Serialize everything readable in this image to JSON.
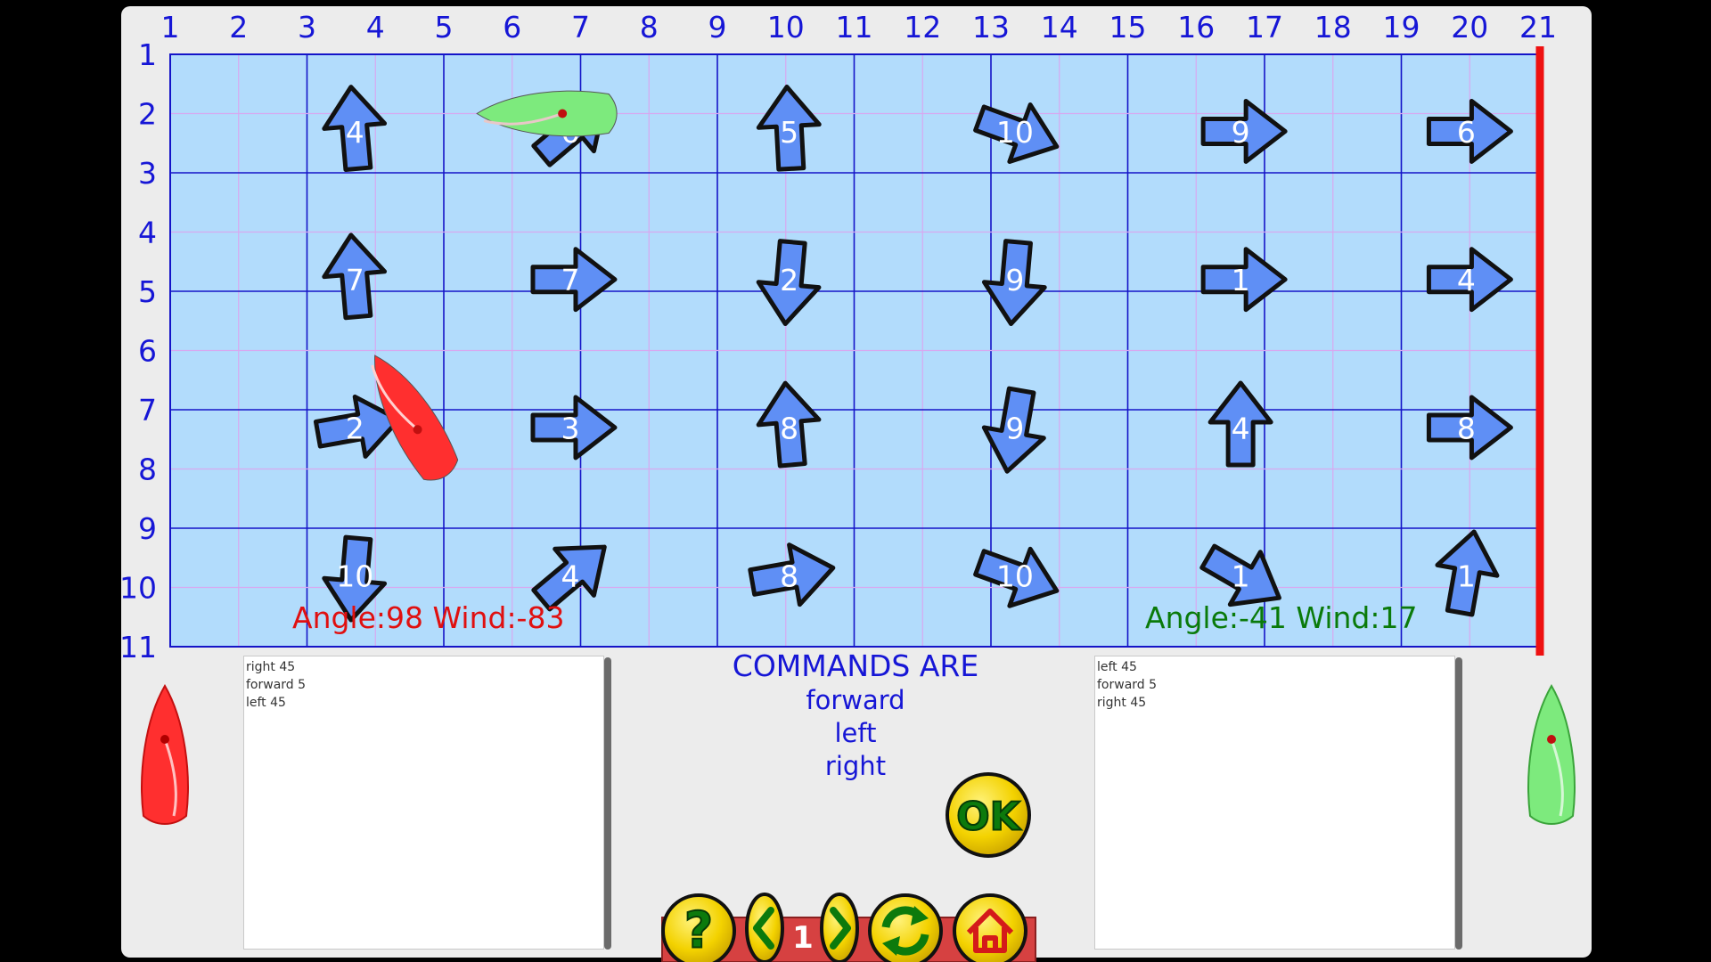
{
  "grid": {
    "columns": [
      "1",
      "2",
      "3",
      "4",
      "5",
      "6",
      "7",
      "8",
      "9",
      "10",
      "11",
      "12",
      "13",
      "14",
      "15",
      "16",
      "17",
      "18",
      "19",
      "20",
      "21"
    ],
    "rows": [
      "1",
      "2",
      "3",
      "4",
      "5",
      "6",
      "7",
      "8",
      "9",
      "10",
      "11"
    ]
  },
  "arrows": [
    {
      "label": "4",
      "col": 3.7,
      "row": 2.3,
      "angle": -5
    },
    {
      "label": "6",
      "col": 6.85,
      "row": 2.3,
      "angle": -40
    },
    {
      "label": "5",
      "col": 10.05,
      "row": 2.3,
      "angle": -3
    },
    {
      "label": "10",
      "col": 13.35,
      "row": 2.3,
      "angle": 20
    },
    {
      "label": "9",
      "col": 16.65,
      "row": 2.3,
      "angle": 0
    },
    {
      "label": "6",
      "col": 19.95,
      "row": 2.3,
      "angle": 0
    },
    {
      "label": "7",
      "col": 3.7,
      "row": 4.8,
      "angle": -5
    },
    {
      "label": "7",
      "col": 6.85,
      "row": 4.8,
      "angle": 0
    },
    {
      "label": "2",
      "col": 10.05,
      "row": 4.8,
      "angle": 95
    },
    {
      "label": "9",
      "col": 13.35,
      "row": 4.8,
      "angle": 95
    },
    {
      "label": "1",
      "col": 16.65,
      "row": 4.8,
      "angle": 0
    },
    {
      "label": "4",
      "col": 19.95,
      "row": 4.8,
      "angle": 0
    },
    {
      "label": "2",
      "col": 3.7,
      "row": 7.3,
      "angle": -10
    },
    {
      "label": "3",
      "col": 6.85,
      "row": 7.3,
      "angle": 0
    },
    {
      "label": "8",
      "col": 10.05,
      "row": 7.3,
      "angle": -5
    },
    {
      "label": "9",
      "col": 13.35,
      "row": 7.3,
      "angle": 100
    },
    {
      "label": "4",
      "col": 16.65,
      "row": 7.3,
      "angle": 0,
      "up": true
    },
    {
      "label": "8",
      "col": 19.95,
      "row": 7.3,
      "angle": 0
    },
    {
      "label": "10",
      "col": 3.7,
      "row": 9.8,
      "angle": 95
    },
    {
      "label": "4",
      "col": 6.85,
      "row": 9.8,
      "angle": -40
    },
    {
      "label": "8",
      "col": 10.05,
      "row": 9.8,
      "angle": -10
    },
    {
      "label": "10",
      "col": 13.35,
      "row": 9.8,
      "angle": 20
    },
    {
      "label": "1",
      "col": 16.65,
      "row": 9.8,
      "angle": 30
    },
    {
      "label": "1",
      "col": 19.95,
      "row": 9.8,
      "angle": -80
    }
  ],
  "boats": {
    "red": {
      "col": 4.5,
      "row": 7.1,
      "angle": 60,
      "color": "#ff2f2f"
    },
    "green": {
      "col": 6.5,
      "row": 2.0,
      "angle": 0,
      "color": "#7dea7d"
    }
  },
  "status": {
    "red": {
      "text": "Angle:98 Wind:-83",
      "color": "#e01010"
    },
    "green": {
      "text": "Angle:-41 Wind:17",
      "color": "#0a7a0a"
    }
  },
  "left_panel": {
    "lines": [
      "right 45",
      "forward 5",
      "left 45"
    ]
  },
  "right_panel": {
    "lines": [
      "left 45",
      "forward 5",
      "right 45"
    ]
  },
  "commands": {
    "title": "COMMANDS ARE",
    "items": [
      "forward",
      "left",
      "right"
    ]
  },
  "buttons": {
    "ok": "OK",
    "level": "1"
  },
  "colors": {
    "water": "#b2dcfc",
    "grid_major": "#1414c8",
    "grid_minor": "#d8a8f0",
    "finish_line": "#ee1111",
    "arrow_fill": "#5f8ff5",
    "numbers": "#1616d6"
  },
  "icons": [
    "help-icon",
    "previous-icon",
    "next-icon",
    "reload-icon",
    "home-icon"
  ]
}
